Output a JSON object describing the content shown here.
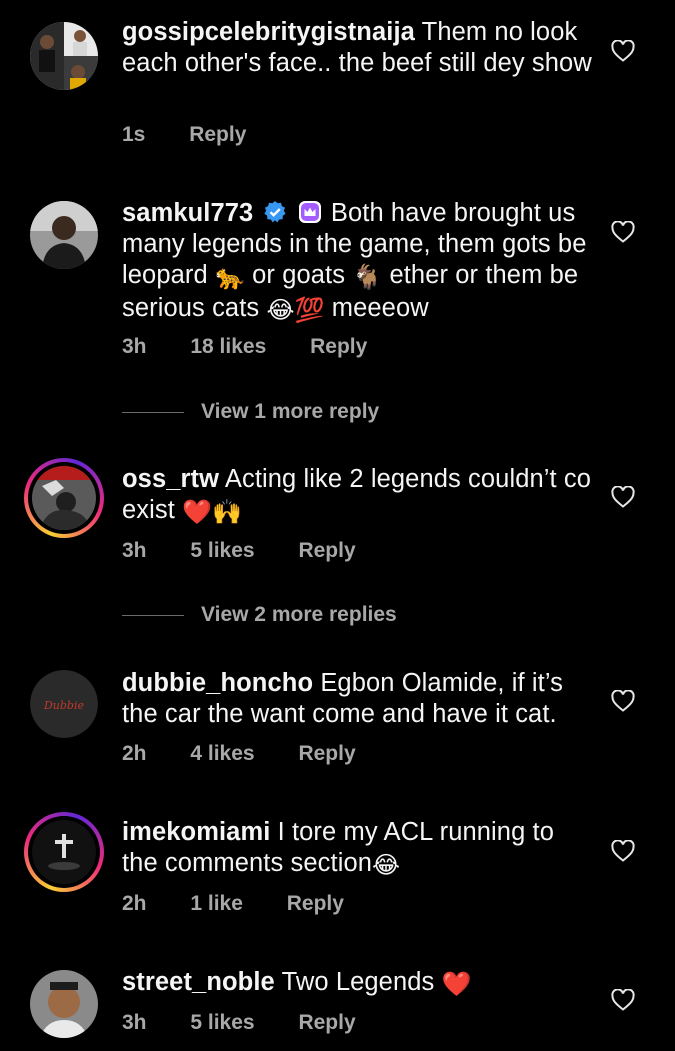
{
  "comments": [
    {
      "username": "gossipcelebritygistnaija",
      "text": "Them no look each other's face.. the beef still dey show",
      "time": "1s",
      "likes": "",
      "reply": "Reply"
    },
    {
      "username": "samkul773",
      "text_a": "Both have brought us many legends in the game, them gots be leopard",
      "text_b": "or goats",
      "text_c": "ether or them be serious cats",
      "text_d": "meeeow",
      "emoji_leopard": "🐆",
      "emoji_goat": "🐐",
      "emoji_laugh": "😂",
      "emoji_100": "💯",
      "time": "3h",
      "likes": "18 likes",
      "reply": "Reply",
      "view_more": "View 1 more reply"
    },
    {
      "username": "oss_rtw",
      "text": "Acting like 2 legends couldn’t co exist",
      "emoji": "❤️🙌",
      "time": "3h",
      "likes": "5 likes",
      "reply": "Reply",
      "view_more": "View 2 more replies"
    },
    {
      "username": "dubbie_honcho",
      "text": "Egbon Olamide, if it’s the car the want come and have it cat.",
      "avatar_text": "Dubbie",
      "time": "2h",
      "likes": "4 likes",
      "reply": "Reply"
    },
    {
      "username": "imekomiami",
      "text": "I tore my ACL running to the comments section",
      "emoji": "😂",
      "time": "2h",
      "likes": "1 like",
      "reply": "Reply"
    },
    {
      "username": "street_noble",
      "text": "Two Legends",
      "emoji": "❤️",
      "time": "3h",
      "likes": "5 likes",
      "reply": "Reply"
    }
  ],
  "colors": {
    "background": "#000000",
    "text": "#f5f5f5",
    "secondary": "#a8a8a8",
    "verified": "#3897f0",
    "subscriber": "#a35cff"
  },
  "icons": {
    "like": "heart-outline-icon",
    "verified": "verified-badge-icon",
    "subscriber": "crown-badge-icon"
  }
}
